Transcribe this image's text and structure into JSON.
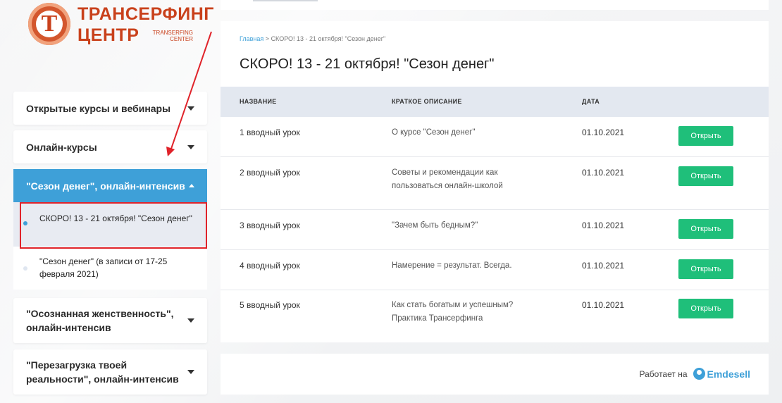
{
  "logo": {
    "line1": "ТРАНСЕРФИНГ",
    "line2": "ЦЕНТР",
    "sub1": "TRANSERFING",
    "sub2": "CENTER",
    "letter": "Т"
  },
  "sidebar": {
    "items": [
      {
        "label": "Открытые курсы и вебинары"
      },
      {
        "label": "Онлайн-курсы"
      },
      {
        "label": "\"Сезон денег\", онлайн-интенсив"
      },
      {
        "label": "\"Осознанная женственность\", онлайн-интенсив"
      },
      {
        "label": "\"Перезагрузка твоей реальности\", онлайн-интенсив"
      }
    ],
    "subitems": [
      {
        "label": "СКОРО! 13 - 21 октября! \"Сезон денег\""
      },
      {
        "label": "\"Сезон денег\" (в записи от 17-25 февраля 2021)"
      }
    ]
  },
  "breadcrumb": {
    "home": "Главная",
    "separator": ">",
    "current": "СКОРО! 13 - 21 октября! \"Сезон денег\""
  },
  "page": {
    "title": "СКОРО! 13 - 21 октября! \"Сезон денег\""
  },
  "table": {
    "headers": [
      "НАЗВАНИЕ",
      "КРАТКОЕ ОПИСАНИЕ",
      "ДАТА"
    ],
    "rows": [
      {
        "name": "1 вводный урок",
        "desc": "О курсе \"Сезон денег\"",
        "date": "01.10.2021",
        "button": "Открыть"
      },
      {
        "name": "2 вводный урок",
        "desc": "Советы и рекомендации как пользоваться онлайн-школой",
        "date": "01.10.2021",
        "button": "Открыть"
      },
      {
        "name": "3 вводный урок",
        "desc": "\"Зачем быть бедным?\"",
        "date": "01.10.2021",
        "button": "Открыть"
      },
      {
        "name": "4 вводный урок",
        "desc": "Намерение = результат. Всегда.",
        "date": "01.10.2021",
        "button": "Открыть"
      },
      {
        "name": "5 вводный урок",
        "desc": "Как стать богатым и успешным? Практика Трансерфинга",
        "date": "01.10.2021",
        "button": "Открыть"
      }
    ]
  },
  "footer": {
    "powered_by": "Работает на",
    "brand": "Emdesell"
  },
  "colors": {
    "accent": "#3ea0d8",
    "button": "#1fbf7a",
    "logo": "#c9411c",
    "highlight": "#e0232a"
  }
}
